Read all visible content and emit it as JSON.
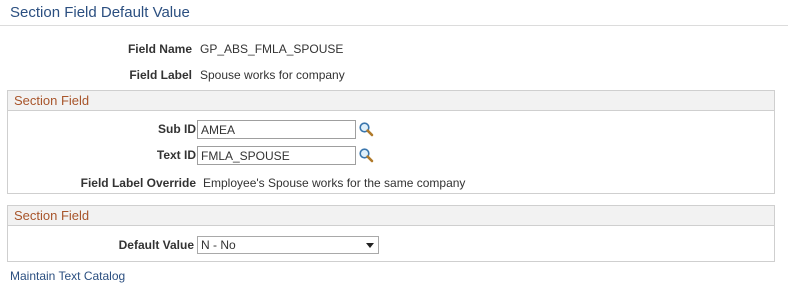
{
  "page": {
    "title": "Section Field Default Value"
  },
  "field": {
    "name_label": "Field Name",
    "name_value": "GP_ABS_FMLA_SPOUSE",
    "label_label": "Field Label",
    "label_value": "Spouse works for company"
  },
  "section_field": {
    "header": "Section Field",
    "sub_id_label": "Sub ID",
    "sub_id_value": "AMEA",
    "text_id_label": "Text ID",
    "text_id_value": "FMLA_SPOUSE",
    "override_label": "Field Label Override",
    "override_value": "Employee's Spouse works for the same company"
  },
  "default_section": {
    "header": "Section Field",
    "default_value_label": "Default Value",
    "default_value_selected": "N - No"
  },
  "links": {
    "maintain_text_catalog": "Maintain Text Catalog"
  },
  "icons": {
    "lookup": "magnifier-lookup-icon",
    "dropdown": "chevron-down-icon"
  },
  "colors": {
    "title": "#2b4f80",
    "group_header_text": "#a8552b",
    "group_header_bg": "#f2f2f2",
    "border": "#cfcfcf",
    "link": "#2b4f80"
  }
}
